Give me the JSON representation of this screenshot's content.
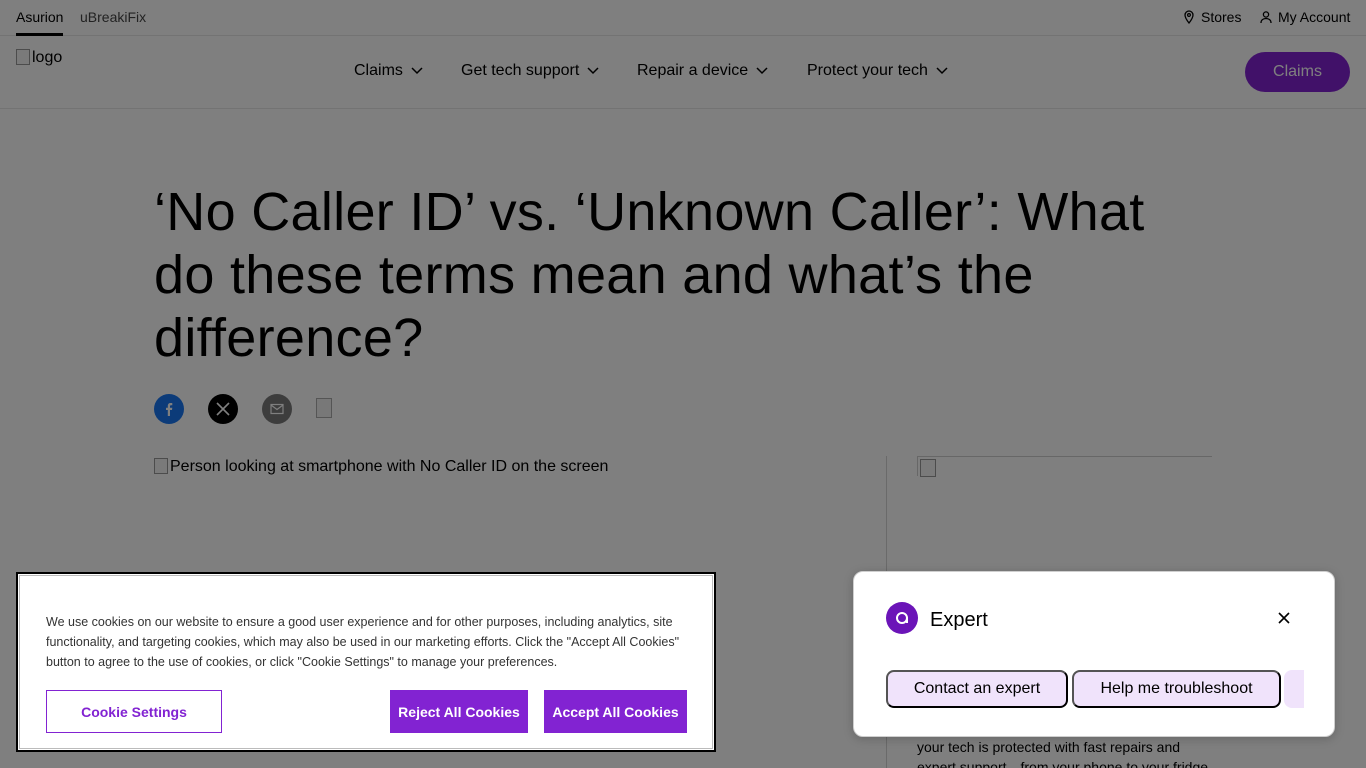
{
  "brand_bar": {
    "tabs": [
      "Asurion",
      "uBreakiFix"
    ],
    "stores": "Stores",
    "account": "My Account"
  },
  "nav": {
    "logo_alt": "logo",
    "items": [
      "Claims",
      "Get tech support",
      "Repair a device",
      "Protect your tech"
    ],
    "cta": "Claims"
  },
  "article": {
    "title": "‘No Caller ID’ vs. ‘Unknown Caller’: What do these terms mean and what’s the difference?",
    "hero_alt": "Person looking at smartphone with No Caller ID on the screen"
  },
  "share_icons": [
    "facebook-icon",
    "x-icon",
    "mail-icon",
    "broken-image-icon"
  ],
  "sidebar": {
    "text": "your tech is protected with fast repairs and expert support—from your phone to your fridge"
  },
  "expert_widget": {
    "title": "Expert",
    "chips": [
      "Contact an expert",
      "Help me troubleshoot"
    ]
  },
  "cookie_banner": {
    "text": "We use cookies on our website to ensure a good user experience and for other purposes, including analytics, site functionality, and targeting cookies, which may also be used in our marketing efforts. Click the \"Accept All Cookies\" button to agree to the use of cookies, or click \"Cookie Settings\" to manage your preferences.",
    "settings_label": "Cookie Settings",
    "reject_label": "Reject All Cookies",
    "accept_label": "Accept All Cookies"
  },
  "colors": {
    "brand_purple": "#8223d2",
    "overlay": "rgba(0,0,0,0.5)"
  }
}
